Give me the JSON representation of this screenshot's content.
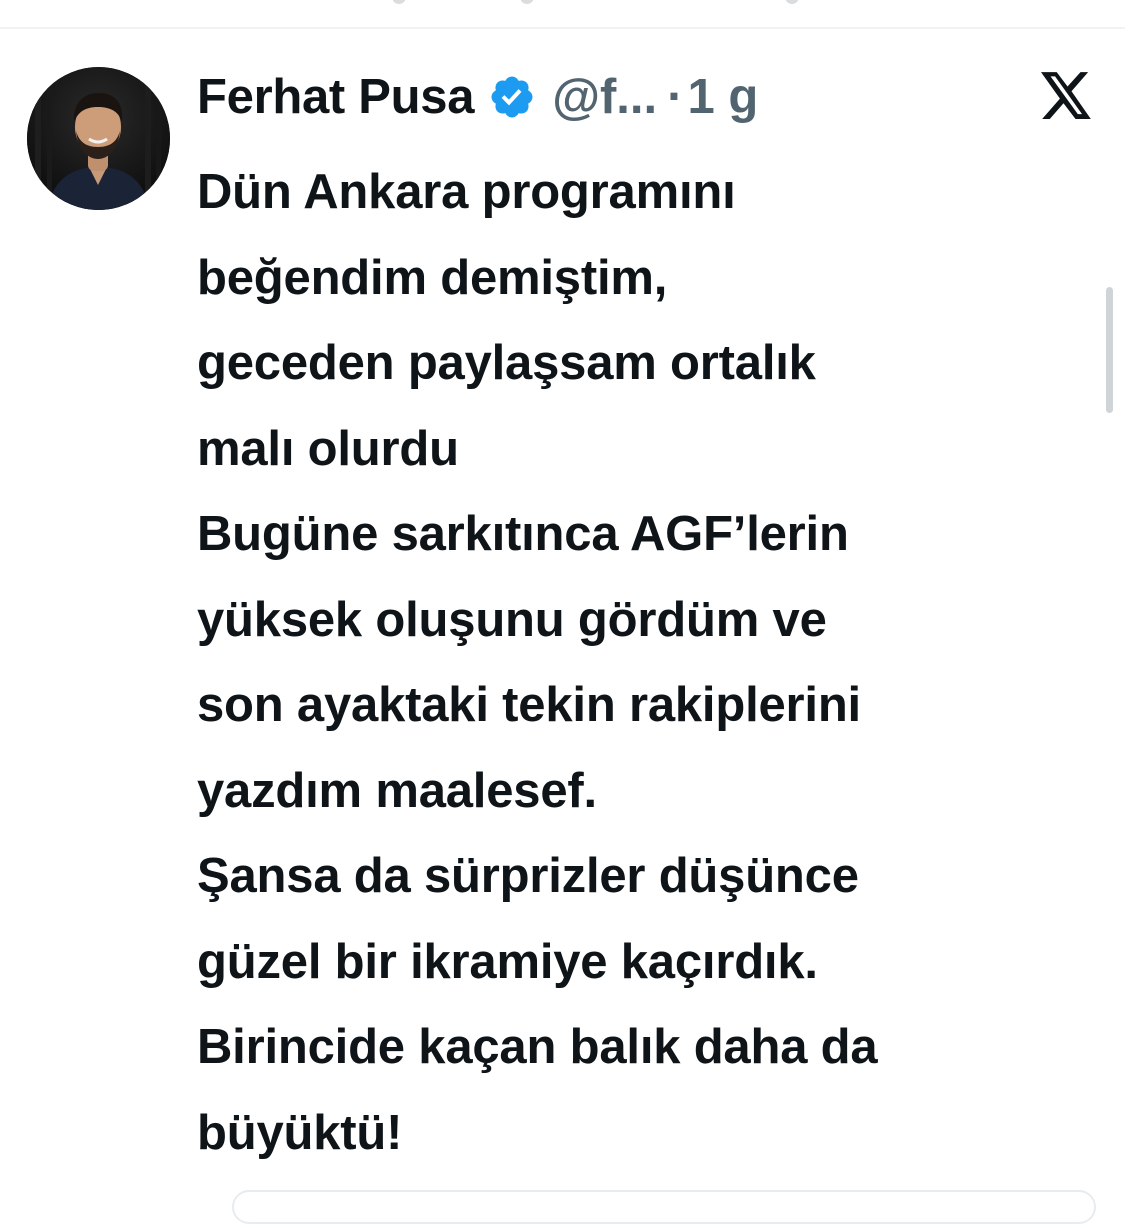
{
  "tweet": {
    "author_name": "Ferhat Pusa",
    "handle": "@f...",
    "separator": "·",
    "time_ago": "1 g",
    "lines": [
      "Dün Ankara programını",
      "beğendim demiştim,",
      "geceden paylaşsam ortalık",
      "malı olurdu",
      "Bugüne sarkıtınca AGF’lerin",
      "yüksek oluşunu gördüm ve",
      "son ayaktaki tekin rakiplerini",
      "yazdım maalesef.",
      "Şansa da sürprizler düşünce",
      "güzel bir ikramiye kaçırdık.",
      "Birincide kaçan balık daha da",
      "büyüktü!"
    ]
  },
  "icons": {
    "verified": "verified-badge-icon",
    "brand": "x-logo-icon",
    "avatar": "avatar"
  },
  "colors": {
    "text": "#0f1419",
    "secondary_text": "#536471",
    "verified_blue": "#1d9bf0",
    "divider": "#eff3f4"
  }
}
